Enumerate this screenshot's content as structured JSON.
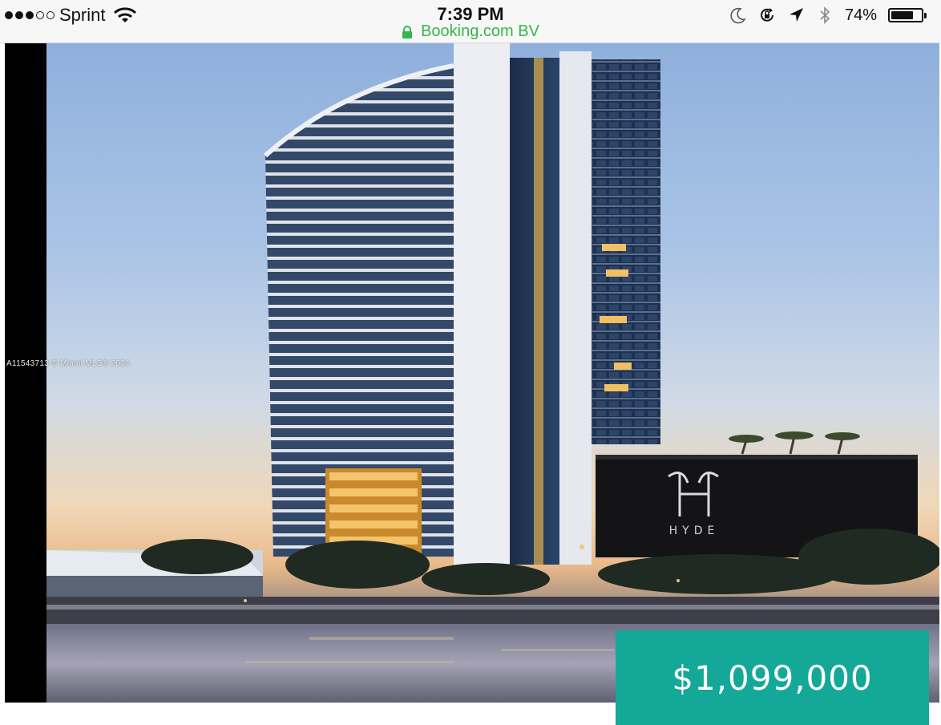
{
  "status_bar": {
    "carrier": "Sprint",
    "signal_bars_full": 3,
    "signal_bars_total": 5,
    "time": "7:39 PM",
    "site": "Booking.com BV",
    "battery_text": "74%",
    "battery_level": 0.74,
    "icons": [
      "moon-icon",
      "rotation-lock-icon",
      "location-arrow-icon",
      "bluetooth-icon"
    ]
  },
  "listing": {
    "watermark": "A11543713 © Miami MLS® 2024",
    "building_sign": "HYDE",
    "price": "$1,099,000"
  },
  "colors": {
    "price_bg": "#14a898",
    "secure_green": "#39b54a"
  }
}
